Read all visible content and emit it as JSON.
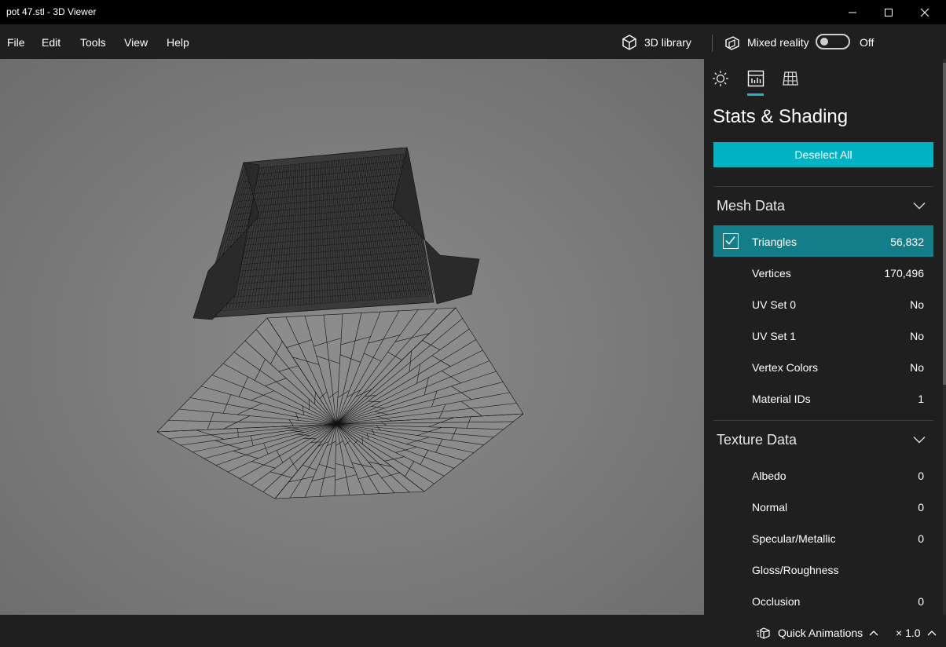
{
  "window": {
    "title": "pot 47.stl - 3D Viewer"
  },
  "menu": {
    "items": [
      "File",
      "Edit",
      "Tools",
      "View",
      "Help"
    ],
    "library_label": "3D library",
    "mixed_reality_label": "Mixed reality",
    "mixed_reality_state": "Off",
    "mixed_reality_on": false
  },
  "panel": {
    "title": "Stats & Shading",
    "deselect_label": "Deselect All",
    "active_tab": "stats-tab",
    "mesh_section": {
      "title": "Mesh Data",
      "rows": [
        {
          "label": "Triangles",
          "value": "56,832",
          "checked": true
        },
        {
          "label": "Vertices",
          "value": "170,496"
        },
        {
          "label": "UV Set 0",
          "value": "No"
        },
        {
          "label": "UV Set 1",
          "value": "No"
        },
        {
          "label": "Vertex Colors",
          "value": "No"
        },
        {
          "label": "Material IDs",
          "value": "1"
        }
      ]
    },
    "texture_section": {
      "title": "Texture Data",
      "rows": [
        {
          "label": "Albedo",
          "value": "0"
        },
        {
          "label": "Normal",
          "value": "0"
        },
        {
          "label": "Specular/Metallic",
          "value": "0"
        },
        {
          "label": "Gloss/Roughness",
          "value": ""
        },
        {
          "label": "Occlusion",
          "value": "0"
        }
      ]
    }
  },
  "status": {
    "quick_animations_label": "Quick Animations",
    "speed": "× 1.0"
  },
  "colors": {
    "accent": "#00b2c2",
    "selected_row": "#137d88",
    "panel_bg": "#1f1f1f"
  },
  "icons": {
    "tabs": [
      "sun-icon",
      "stats-icon",
      "grid-icon"
    ],
    "library": "cube-icon",
    "mixed_reality": "headset-icon",
    "quick_animations": "animation-icon"
  }
}
